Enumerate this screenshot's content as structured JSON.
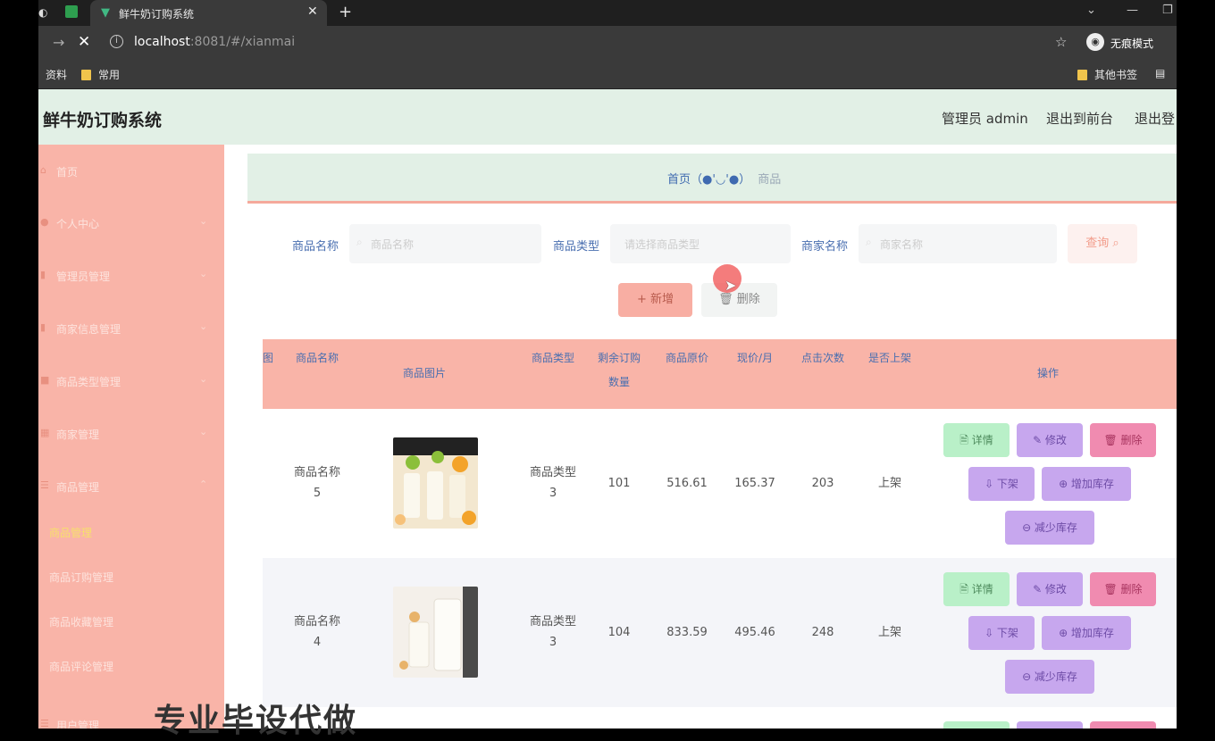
{
  "browser": {
    "tab_title": "鲜牛奶订购系统",
    "url_host": "localhost",
    "url_rest": ":8081/#/xianmai",
    "incognito_label": "无痕模式",
    "bookmarks": [
      "资料",
      "常用"
    ],
    "other_bookmarks": "其他书签"
  },
  "header": {
    "brand": "鲜牛奶订购系统",
    "user": "管理员 admin",
    "to_front": "退出到前台",
    "logout": "退出登"
  },
  "sidebar": {
    "items": [
      {
        "label": "首页",
        "icon": "home-icon"
      },
      {
        "label": "个人中心",
        "icon": "user-icon"
      },
      {
        "label": "管理员管理",
        "icon": "admin-icon"
      },
      {
        "label": "商家信息管理",
        "icon": "shop-icon"
      },
      {
        "label": "商品类型管理",
        "icon": "category-icon"
      },
      {
        "label": "商家管理",
        "icon": "merchant-icon"
      },
      {
        "label": "商品管理",
        "icon": "goods-icon"
      }
    ],
    "subitems": [
      {
        "label": "商品管理",
        "active": true
      },
      {
        "label": "商品订购管理",
        "active": false
      },
      {
        "label": "商品收藏管理",
        "active": false
      },
      {
        "label": "商品评论管理",
        "active": false
      }
    ],
    "bottom_item": "用户管理"
  },
  "breadcrumb": {
    "home": "首页（●'◡'●）",
    "current": "商品"
  },
  "search": {
    "name_label": "商品名称",
    "name_placeholder": "商品名称",
    "type_label": "商品类型",
    "type_placeholder": "请选择商品类型",
    "shop_label": "商家名称",
    "shop_placeholder": "商家名称",
    "query_button": "查询 ⌕"
  },
  "actions": {
    "add": "+ 新增",
    "delete": "🗑 删除"
  },
  "table": {
    "headers": {
      "col_cut": "图",
      "name": "商品名称",
      "image": "商品图片",
      "type": "商品类型",
      "stock_line1": "剩余订购",
      "stock_line2": "数量",
      "price": "商品原价",
      "month_price": "现价/月",
      "clicks": "点击次数",
      "on_shelf": "是否上架",
      "ops": "操作"
    },
    "rows": [
      {
        "name_line1": "商品名称",
        "name_line2": "5",
        "type_line1": "商品类型",
        "type_line2": "3",
        "stock": "101",
        "price": "516.61",
        "month_price": "165.37",
        "clicks": "203",
        "on_shelf": "上架"
      },
      {
        "name_line1": "商品名称",
        "name_line2": "4",
        "type_line1": "商品类型",
        "type_line2": "3",
        "stock": "104",
        "price": "833.59",
        "month_price": "495.46",
        "clicks": "248",
        "on_shelf": "上架"
      }
    ],
    "ops": {
      "detail": "🗎 详情",
      "edit": "✎ 修改",
      "delete": "🗑 删除",
      "off_shelf": "⇩ 下架",
      "add_stock": "⊕ 增加库存",
      "reduce_stock": "⊖ 减少库存"
    }
  },
  "overlay_text": "专业毕设代做"
}
